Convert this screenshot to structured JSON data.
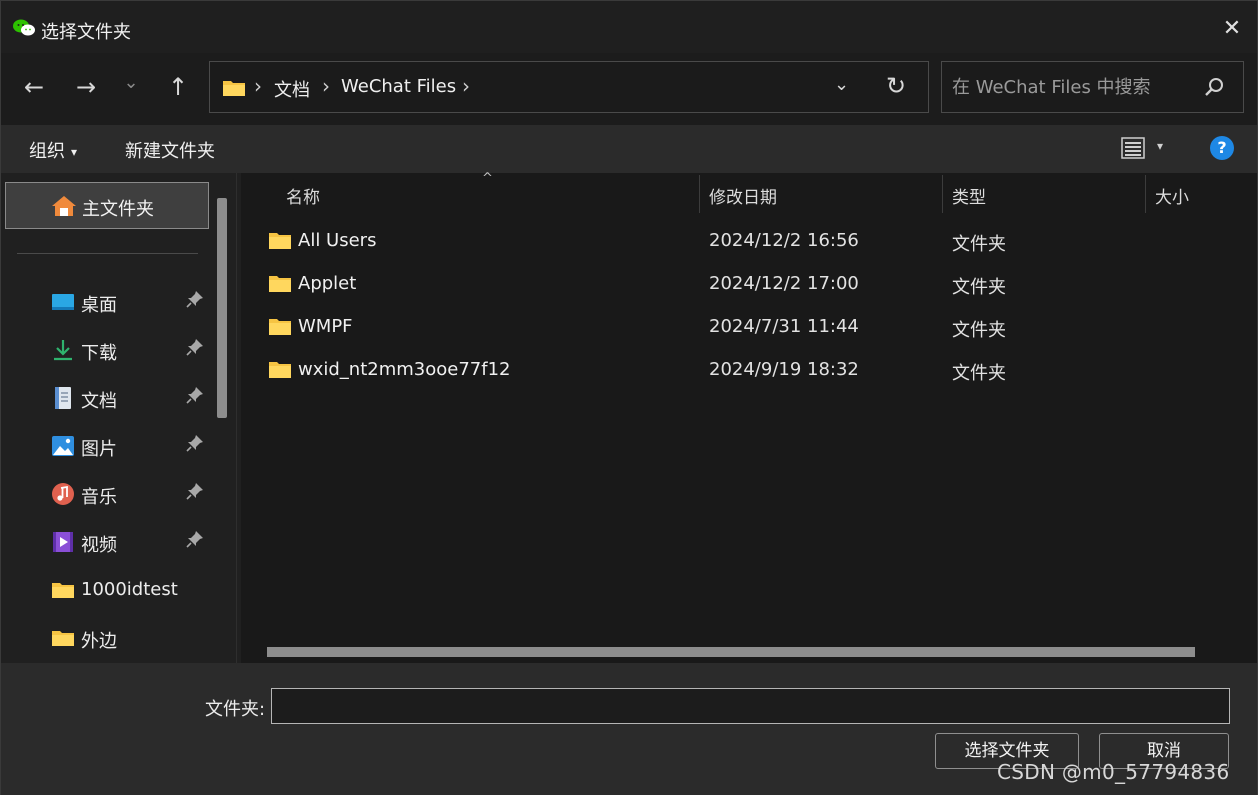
{
  "window": {
    "title": "选择文件夹",
    "close_glyph": "✕"
  },
  "nav": {
    "back_glyph": "←",
    "forward_glyph": "→",
    "recent_glyph": "⌄",
    "up_glyph": "↑",
    "breadcrumb": [
      "文档",
      "WeChat Files"
    ],
    "separator": "›",
    "dropdown_glyph": "⌄",
    "refresh_glyph": "↻",
    "search_placeholder": "在 WeChat Files 中搜索"
  },
  "toolbar": {
    "organize_label": "组织",
    "caret": "▾",
    "new_folder_label": "新建文件夹",
    "help_glyph": "?"
  },
  "sidebar": {
    "home_label": "主文件夹",
    "pin_glyph": "📌",
    "items": [
      {
        "label": "桌面",
        "icon": "desktop-icon",
        "pinned": true
      },
      {
        "label": "下载",
        "icon": "download-icon",
        "pinned": true
      },
      {
        "label": "文档",
        "icon": "documents-icon",
        "pinned": true
      },
      {
        "label": "图片",
        "icon": "pictures-icon",
        "pinned": true
      },
      {
        "label": "音乐",
        "icon": "music-icon",
        "pinned": true
      },
      {
        "label": "视频",
        "icon": "videos-icon",
        "pinned": true
      },
      {
        "label": "1000idtest",
        "icon": "folder-icon",
        "pinned": false
      },
      {
        "label": "外边",
        "icon": "folder-icon",
        "pinned": false
      }
    ]
  },
  "file_list": {
    "columns": {
      "name": "名称",
      "modified": "修改日期",
      "type": "类型",
      "size": "大小"
    },
    "sort_glyph": "^",
    "rows": [
      {
        "name": "All Users",
        "modified": "2024/12/2 16:56",
        "type": "文件夹"
      },
      {
        "name": "Applet",
        "modified": "2024/12/2 17:00",
        "type": "文件夹"
      },
      {
        "name": "WMPF",
        "modified": "2024/7/31 11:44",
        "type": "文件夹"
      },
      {
        "name": "wxid_nt2mm3ooe77f12",
        "modified": "2024/9/19 18:32",
        "type": "文件夹"
      }
    ]
  },
  "footer": {
    "folder_label": "文件夹:",
    "folder_value": "",
    "select_button": "选择文件夹",
    "cancel_button": "取消"
  },
  "watermark": "CSDN @m0_57794836",
  "colors": {
    "accent": "#1e88e5",
    "folder": "#f6c443",
    "wechat": "#2dc100"
  }
}
